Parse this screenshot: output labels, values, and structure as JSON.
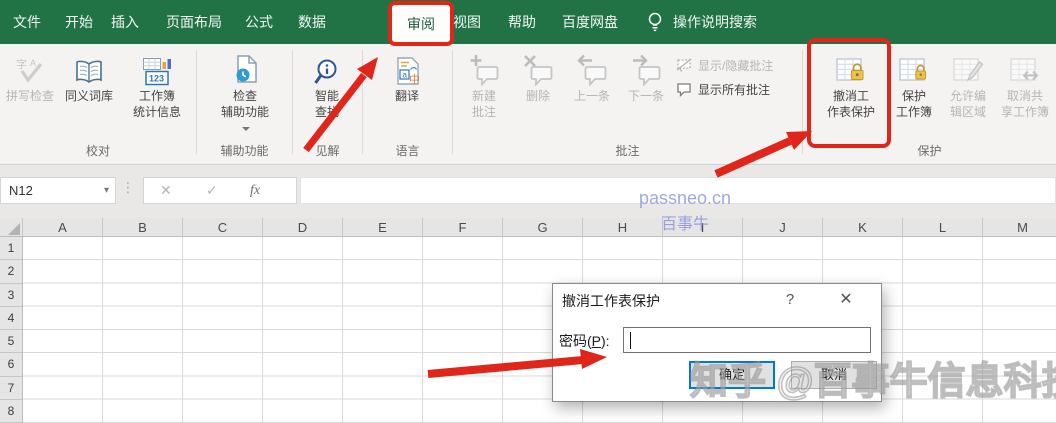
{
  "menubar": {
    "items": [
      "文件",
      "开始",
      "插入",
      "页面布局",
      "公式",
      "数据",
      "审阅",
      "视图",
      "帮助",
      "百度网盘"
    ],
    "active_item": "审阅",
    "search_label": "操作说明搜索"
  },
  "ribbon": {
    "groups": {
      "proofing": {
        "label": "校对",
        "buttons": {
          "spellcheck": {
            "label": "拼写检查",
            "disabled": true
          },
          "thesaurus": {
            "label": "同义词库",
            "disabled": false
          },
          "workbook_stats": {
            "label": "工作簿\n统计信息",
            "disabled": false
          }
        }
      },
      "accessibility": {
        "label": "辅助功能",
        "buttons": {
          "check_accessibility": {
            "label": "检查\n辅助功能",
            "disabled": false
          }
        }
      },
      "insights": {
        "label": "见解",
        "buttons": {
          "smart_lookup": {
            "label": "智能\n查找",
            "disabled": false
          }
        }
      },
      "language": {
        "label": "语言",
        "buttons": {
          "translate": {
            "label": "翻译",
            "disabled": false
          }
        }
      },
      "comments": {
        "label": "批注",
        "buttons": {
          "new_comment": {
            "label": "新建\n批注",
            "disabled": true
          },
          "delete_comment": {
            "label": "删除",
            "disabled": true
          },
          "previous_comment": {
            "label": "上一条",
            "disabled": true
          },
          "next_comment": {
            "label": "下一条",
            "disabled": true
          },
          "show_hide_comment": {
            "label": "显示/隐藏批注",
            "disabled": true
          },
          "show_all_comments": {
            "label": "显示所有批注",
            "disabled": false
          }
        }
      },
      "protect": {
        "label": "保护",
        "buttons": {
          "unprotect_sheet": {
            "label": "撤消工\n作表保护",
            "disabled": false
          },
          "protect_workbook": {
            "label": "保护\n工作簿",
            "disabled": false
          },
          "allow_edit_ranges": {
            "label": "允许编\n辑区域",
            "disabled": true
          },
          "unshare_workbook": {
            "label": "取消共\n享工作簿",
            "disabled": true
          }
        }
      }
    }
  },
  "formula_bar": {
    "name_box": "N12",
    "dropdown_glyph": "▾",
    "cancel_glyph": "✕",
    "enter_glyph": "✓",
    "fx_glyph": "fx",
    "formula_value": ""
  },
  "grid": {
    "columns": [
      "A",
      "B",
      "C",
      "D",
      "E",
      "F",
      "G",
      "H",
      "I",
      "J",
      "K",
      "L",
      "M"
    ],
    "rows": [
      "1",
      "2",
      "3",
      "4",
      "5",
      "6",
      "7",
      "8"
    ]
  },
  "dialog": {
    "title": "撤消工作表保护",
    "help_glyph": "?",
    "close_glyph": "✕",
    "password_label_prefix": "密码(",
    "password_access_key": "P",
    "password_label_suffix": "):",
    "password_value": "",
    "ok_label": "确定",
    "cancel_label": "取消"
  },
  "watermarks": {
    "formula_line1": "passneo.cn",
    "formula_line2": "百事牛",
    "bottom": "知乎 @百事牛信息科技"
  },
  "annotations": {
    "highlight_color": "#e0251b"
  }
}
